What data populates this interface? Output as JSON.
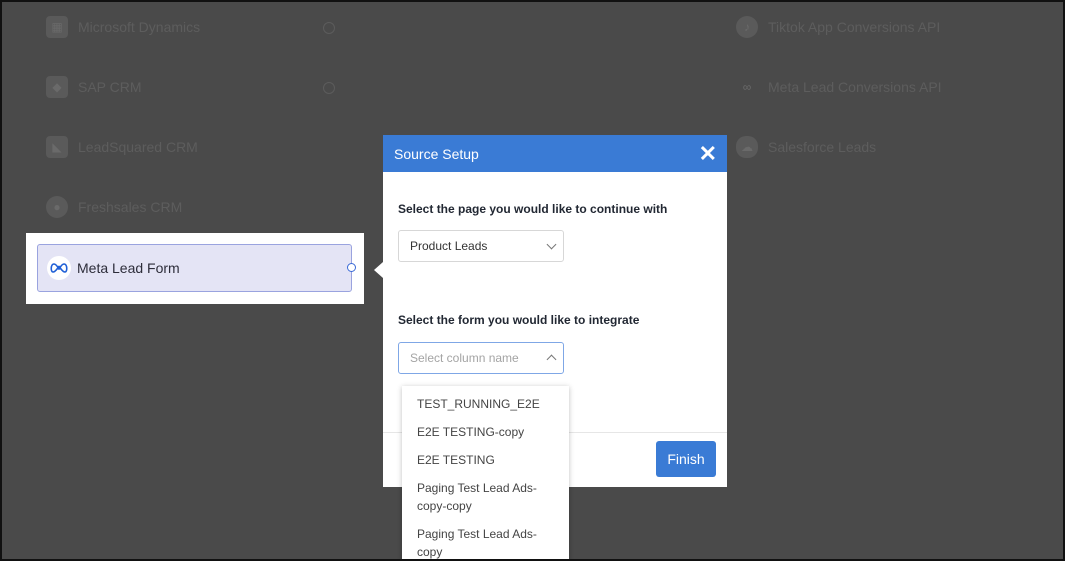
{
  "background_integrations": [
    {
      "label": "Microsoft Dynamics",
      "icon": "microsoft-icon"
    },
    {
      "label": "SAP CRM",
      "icon": "sap-icon"
    },
    {
      "label": "LeadSquared CRM",
      "icon": "leadsquared-icon"
    },
    {
      "label": "Freshsales CRM",
      "icon": "freshsales-icon"
    },
    {
      "label": "Tiktok App Conversions API",
      "icon": "tiktok-icon"
    },
    {
      "label": "Meta Lead Conversions API",
      "icon": "meta-icon"
    },
    {
      "label": "Salesforce Leads",
      "icon": "salesforce-icon"
    }
  ],
  "source": {
    "label": "Meta Lead Form",
    "icon": "meta-icon"
  },
  "modal": {
    "title": "Source Setup",
    "page_label": "Select the page you would like to continue with",
    "page_value": "Product Leads",
    "form_label": "Select the form you would like to integrate",
    "form_placeholder": "Select column name",
    "finish_label": "Finish"
  },
  "dropdown": {
    "options": [
      "TEST_RUNNING_E2E",
      "E2E TESTING-copy",
      "E2E TESTING",
      "Paging Test Lead Ads-copy-copy",
      "Paging Test Lead Ads-copy"
    ]
  },
  "colors": {
    "accent": "#3a7bd5",
    "overlay": "#4a4a4a"
  }
}
